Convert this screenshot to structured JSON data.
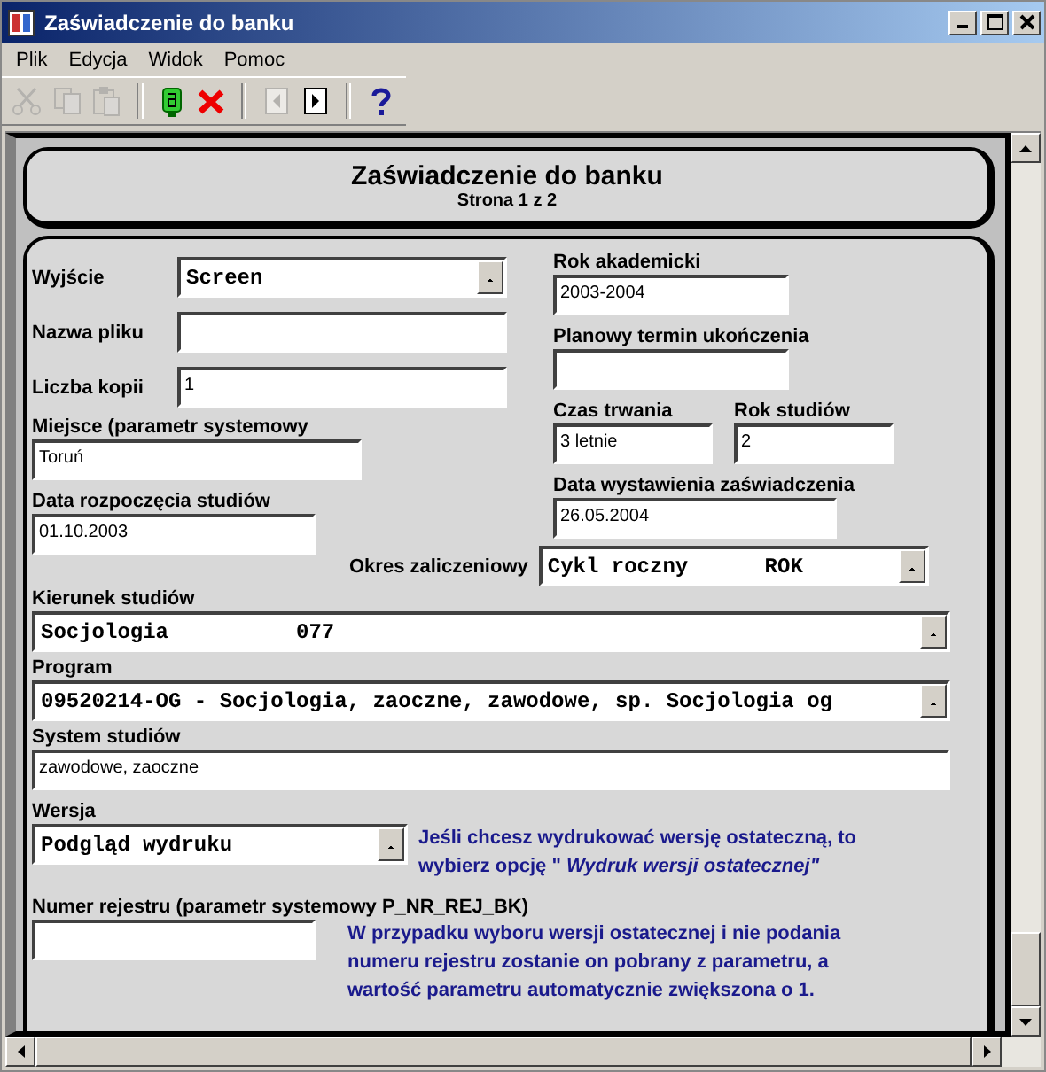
{
  "window": {
    "title": "Zaświadczenie do banku"
  },
  "menu": [
    "Plik",
    "Edycja",
    "Widok",
    "Pomoc"
  ],
  "toolbar": [
    {
      "kind": "cut",
      "disabled": true
    },
    {
      "kind": "copy",
      "disabled": true
    },
    {
      "kind": "paste",
      "disabled": true
    },
    {
      "kind": "sep"
    },
    {
      "kind": "run",
      "disabled": false
    },
    {
      "kind": "cancel",
      "disabled": false
    },
    {
      "kind": "sep"
    },
    {
      "kind": "prev",
      "disabled": true
    },
    {
      "kind": "next",
      "disabled": false
    },
    {
      "kind": "sep"
    },
    {
      "kind": "help",
      "disabled": false
    }
  ],
  "header": {
    "title": "Zaświadczenie do banku",
    "subtitle": "Strona 1 z 2"
  },
  "form": {
    "output": {
      "label": "Wyjście",
      "value": "Screen"
    },
    "file_name": {
      "label": "Nazwa pliku"
    },
    "copies": {
      "label": "Liczba kopii",
      "value": "1"
    },
    "place": {
      "label": "Miejsce (parametr systemowy",
      "value": "Toruń"
    },
    "start_date": {
      "label": "Data rozpoczęcia studiów",
      "value": "01.10.2003"
    },
    "academic_year": {
      "label": "Rok akademicki",
      "value": "2003-2004"
    },
    "planned_end": {
      "label": "Planowy termin ukończenia"
    },
    "duration": {
      "label": "Czas trwania",
      "value": "3 letnie"
    },
    "study_year": {
      "label": "Rok studiów",
      "value": "2"
    },
    "issue_date": {
      "label": "Data wystawienia zaświadczenia",
      "value": "26.05.2004"
    },
    "period": {
      "label": "Okres zaliczeniowy",
      "value": "Cykl roczny      ROK"
    },
    "field_of_study": {
      "label": "Kierunek studiów",
      "value": "Socjologia          077"
    },
    "program": {
      "label": "Program",
      "value": "09520214-OG - Socjologia, zaoczne, zawodowe, sp. Socjologia og"
    },
    "system": {
      "label": "System studiów",
      "value": "zawodowe, zaoczne"
    },
    "version": {
      "label": "Wersja",
      "value": "Podgląd wydruku",
      "hint": "Jeśli chcesz wydrukować wersję ostateczną, to wybierz opcję \" *Wydruk wersji ostatecznej\"*"
    },
    "register": {
      "label": "Numer rejestru (parametr systemowy P_NR_REJ_BK)",
      "hint": "W przypadku wyboru wersji ostatecznej i nie podania numeru rejestru zostanie on pobrany z parametru, a wartość parametru automatycznie zwiększona o 1."
    }
  }
}
